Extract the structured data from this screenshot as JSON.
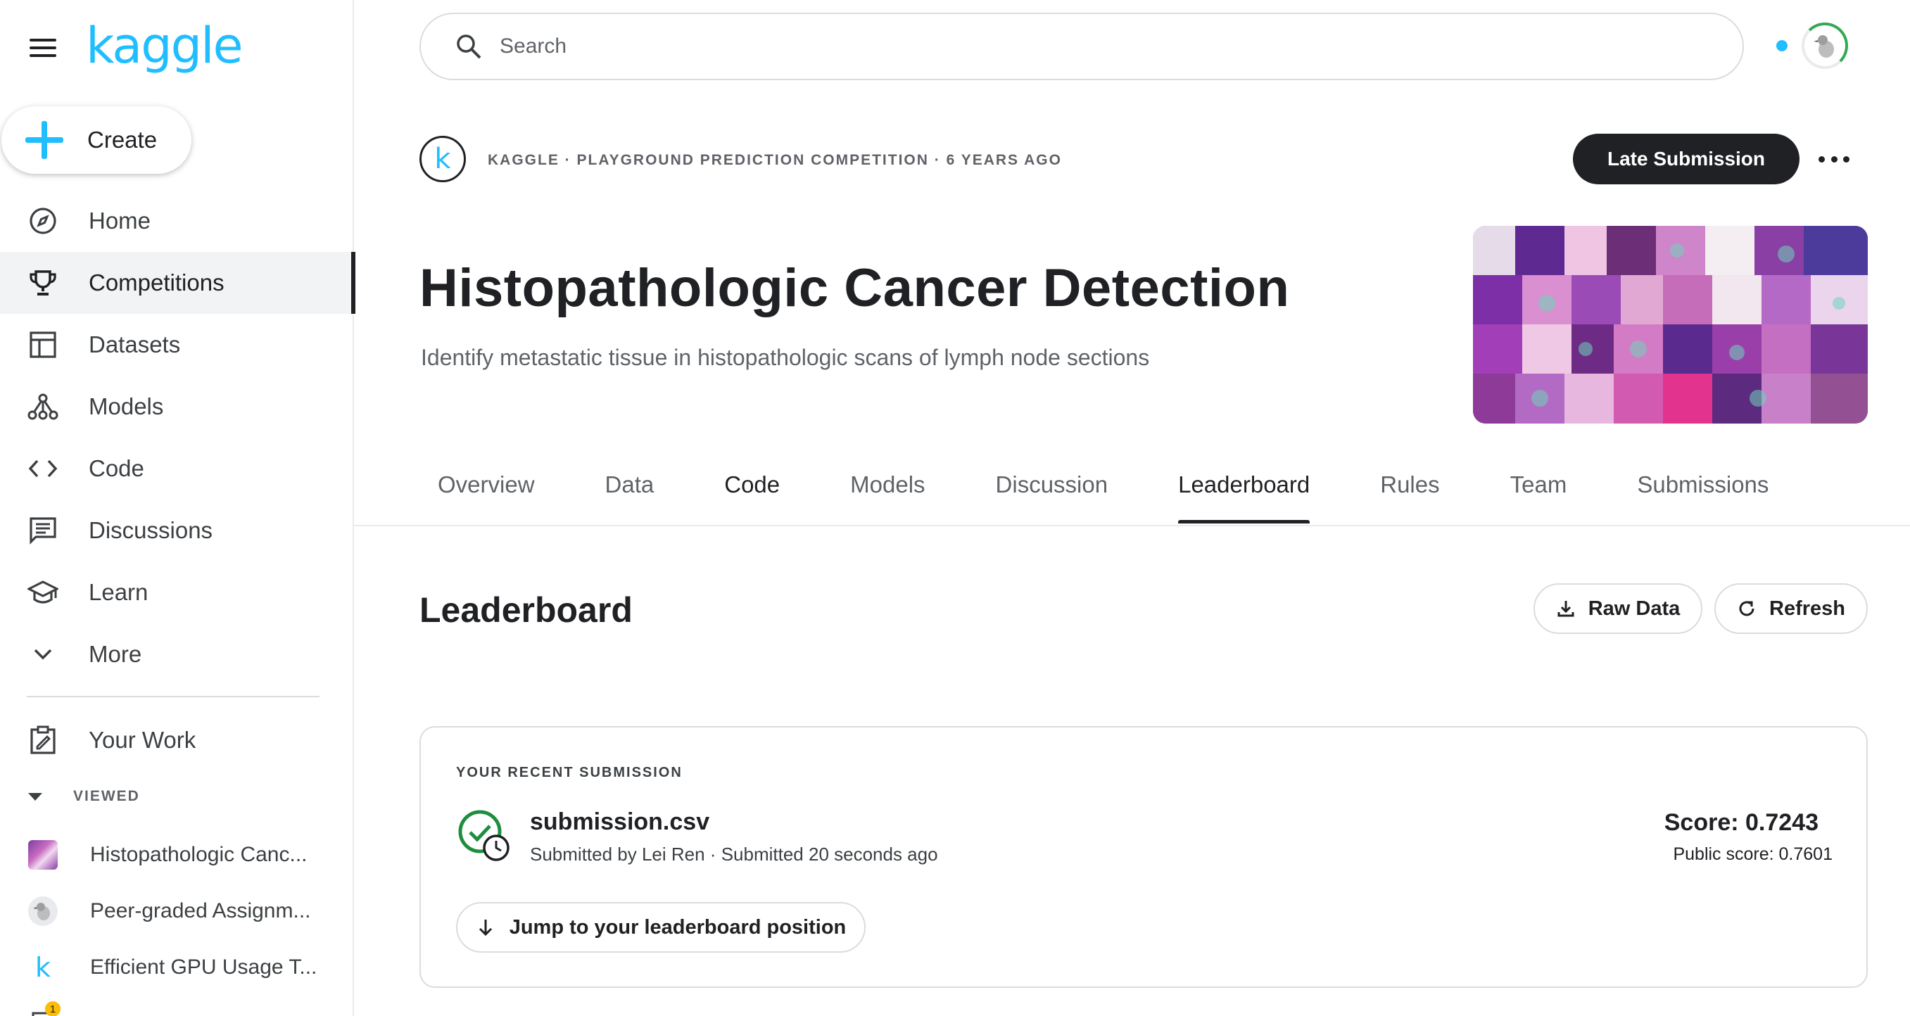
{
  "sidebar": {
    "logo": "kaggle",
    "create_label": "Create",
    "nav": [
      {
        "label": "Home",
        "icon": "compass-icon"
      },
      {
        "label": "Competitions",
        "icon": "trophy-icon",
        "active": true
      },
      {
        "label": "Datasets",
        "icon": "table-icon"
      },
      {
        "label": "Models",
        "icon": "models-icon"
      },
      {
        "label": "Code",
        "icon": "code-icon"
      },
      {
        "label": "Discussions",
        "icon": "discussion-icon"
      },
      {
        "label": "Learn",
        "icon": "graduation-cap-icon"
      },
      {
        "label": "More",
        "icon": "chevron-down-icon"
      }
    ],
    "your_work": "Your Work",
    "viewed_header": "VIEWED",
    "viewed": [
      {
        "label": "Histopathologic Canc..."
      },
      {
        "label": "Peer-graded Assignm..."
      },
      {
        "label": "Efficient GPU Usage T..."
      }
    ],
    "notification_count": "1"
  },
  "topbar": {
    "search_placeholder": "Search"
  },
  "competition": {
    "logo_letter": "k",
    "meta": "KAGGLE · PLAYGROUND PREDICTION COMPETITION · 6 YEARS AGO",
    "late_submission_label": "Late Submission",
    "title": "Histopathologic Cancer Detection",
    "subtitle": "Identify metastatic tissue in histopathologic scans of lymph node sections"
  },
  "tabs": [
    {
      "label": "Overview"
    },
    {
      "label": "Data"
    },
    {
      "label": "Code"
    },
    {
      "label": "Models"
    },
    {
      "label": "Discussion"
    },
    {
      "label": "Leaderboard",
      "active": true
    },
    {
      "label": "Rules"
    },
    {
      "label": "Team"
    },
    {
      "label": "Submissions"
    }
  ],
  "leaderboard": {
    "title": "Leaderboard",
    "raw_data_label": "Raw Data",
    "refresh_label": "Refresh",
    "recent": {
      "header": "YOUR RECENT SUBMISSION",
      "file_name": "submission.csv",
      "meta": "Submitted by Lei Ren · Submitted 20 seconds ago",
      "score": "Score: 0.7243",
      "public_score": "Public score: 0.7601",
      "jump_label": "Jump to your leaderboard position"
    }
  },
  "colors": {
    "brand": "#20beff",
    "success": "#1e8e3e",
    "dark": "#202124"
  }
}
